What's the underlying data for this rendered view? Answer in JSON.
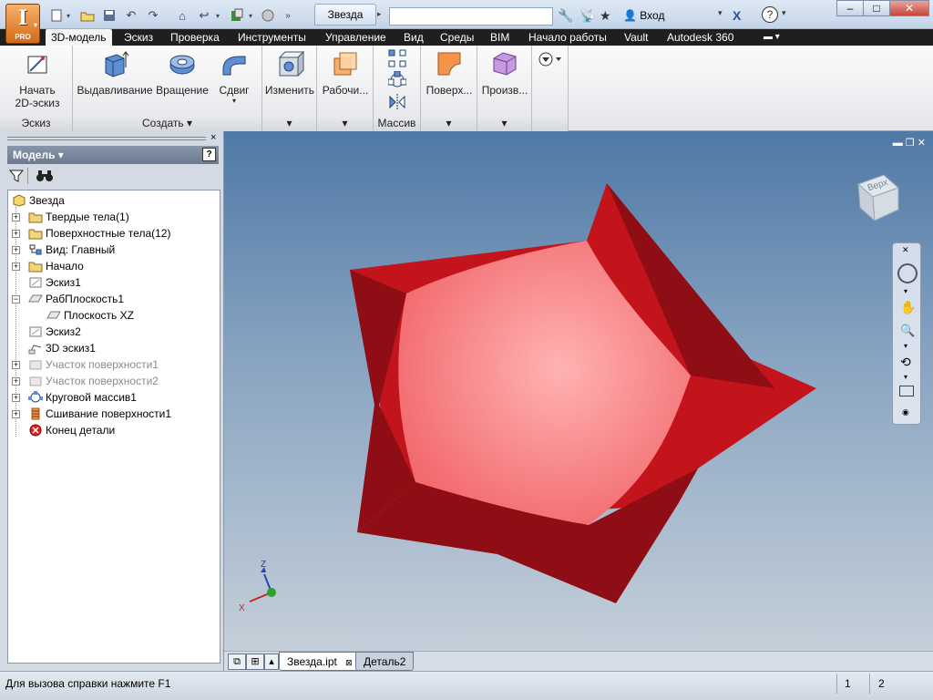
{
  "app": {
    "logo_letter": "I",
    "edition": "PRO",
    "document_tab": "Звезда",
    "search_placeholder": "",
    "login": "Вход",
    "help_symbol": "?",
    "minimize": "–",
    "maximize": "□",
    "close": "✕"
  },
  "ribbon_tabs": [
    {
      "label": "3D-модель",
      "active": true
    },
    {
      "label": "Эскиз",
      "active": false
    },
    {
      "label": "Проверка",
      "active": false
    },
    {
      "label": "Инструменты",
      "active": false
    },
    {
      "label": "Управление",
      "active": false
    },
    {
      "label": "Вид",
      "active": false
    },
    {
      "label": "Среды",
      "active": false
    },
    {
      "label": "BIM",
      "active": false
    },
    {
      "label": "Начало работы",
      "active": false
    },
    {
      "label": "Vault",
      "active": false
    },
    {
      "label": "Autodesk 360",
      "active": false
    }
  ],
  "ribbon": {
    "sketch_group": {
      "label": "Эскиз",
      "start_line1": "Начать",
      "start_line2": "2D-эскиз"
    },
    "create_group": {
      "label": "Создать ▾",
      "extrude": "Выдавливание",
      "revolve": "Вращение",
      "sweep": "Сдвиг"
    },
    "modify_group": {
      "label": "▾",
      "modify": "Изменить"
    },
    "work_group": {
      "label": "▾",
      "work": "Рабочи..."
    },
    "pattern_group": {
      "label": "Массив"
    },
    "surface_group": {
      "label": "▾",
      "surface": "Поверх..."
    },
    "custom_group": {
      "label": "▾",
      "custom": "Произв..."
    }
  },
  "browser": {
    "title": "Модель ▾",
    "help": "?",
    "close": "×",
    "tree": [
      {
        "label": "Звезда",
        "level": 0,
        "expander": "",
        "icon": "part-icon",
        "dim": false
      },
      {
        "label": "Твердые тела(1)",
        "level": 1,
        "expander": "+",
        "icon": "folder-icon",
        "dim": false
      },
      {
        "label": "Поверхностные тела(12)",
        "level": 1,
        "expander": "+",
        "icon": "folder-icon",
        "dim": false
      },
      {
        "label": "Вид: Главный",
        "level": 1,
        "expander": "+",
        "icon": "view-icon",
        "dim": false
      },
      {
        "label": "Начало",
        "level": 1,
        "expander": "+",
        "icon": "folder-icon",
        "dim": false
      },
      {
        "label": "Эскиз1",
        "level": 1,
        "expander": "",
        "icon": "sketch-icon",
        "dim": false
      },
      {
        "label": "РабПлоскость1",
        "level": 1,
        "expander": "−",
        "icon": "plane-icon",
        "dim": false
      },
      {
        "label": "Плоскость XZ",
        "level": 2,
        "expander": "",
        "icon": "plane-icon",
        "dim": false
      },
      {
        "label": "Эскиз2",
        "level": 1,
        "expander": "",
        "icon": "sketch-icon",
        "dim": false
      },
      {
        "label": "3D эскиз1",
        "level": 1,
        "expander": "",
        "icon": "sketch3d-icon",
        "dim": false
      },
      {
        "label": "Участок поверхности1",
        "level": 1,
        "expander": "+",
        "icon": "patch-icon",
        "dim": true
      },
      {
        "label": "Участок поверхности2",
        "level": 1,
        "expander": "+",
        "icon": "patch-icon",
        "dim": true
      },
      {
        "label": "Круговой массив1",
        "level": 1,
        "expander": "+",
        "icon": "pattern-icon",
        "dim": false
      },
      {
        "label": "Сшивание поверхности1",
        "level": 1,
        "expander": "+",
        "icon": "stitch-icon",
        "dim": false
      },
      {
        "label": "Конец детали",
        "level": 1,
        "expander": "",
        "icon": "end-of-part-icon",
        "dim": false
      }
    ]
  },
  "viewport": {
    "viewcube_label": "Верх",
    "triad": {
      "z": "Z",
      "x": "X"
    },
    "star_colors": {
      "face": "#f26a6e",
      "face_center": "#ffb3b3",
      "side_light": "#c3141c",
      "side_dark": "#8f0d14"
    }
  },
  "doc_tabs": [
    {
      "label": "Звезда.ipt",
      "active": true,
      "closable": true
    },
    {
      "label": "Деталь2",
      "active": false,
      "closable": false
    }
  ],
  "status": {
    "text": "Для вызова справки нажмите F1",
    "num1": "1",
    "num2": "2"
  }
}
